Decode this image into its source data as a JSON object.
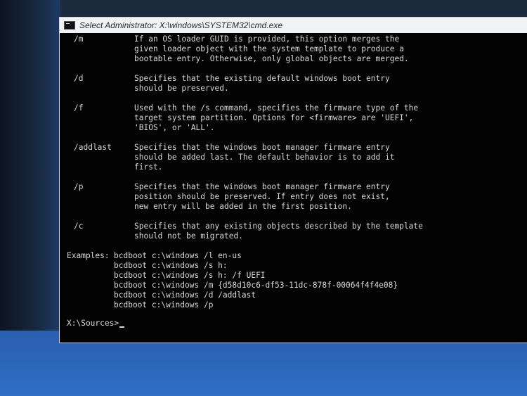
{
  "window": {
    "title": "Select Administrator: X:\\windows\\SYSTEM32\\cmd.exe"
  },
  "console": {
    "options": [
      {
        "flag": "/m",
        "desc": "If an OS loader GUID is provided, this option merges the\ngiven loader object with the system template to produce a\nbootable entry. Otherwise, only global objects are merged."
      },
      {
        "flag": "/d",
        "desc": "Specifies that the existing default windows boot entry\nshould be preserved."
      },
      {
        "flag": "/f",
        "desc": "Used with the /s command, specifies the firmware type of the\ntarget system partition. Options for <firmware> are 'UEFI',\n'BIOS', or 'ALL'."
      },
      {
        "flag": "/addlast",
        "desc": "Specifies that the windows boot manager firmware entry\nshould be added last. The default behavior is to add it\nfirst."
      },
      {
        "flag": "/p",
        "desc": "Specifies that the windows boot manager firmware entry\nposition should be preserved. If entry does not exist,\nnew entry will be added in the first position."
      },
      {
        "flag": "/c",
        "desc": "Specifies that any existing objects described by the template\nshould not be migrated."
      }
    ],
    "examples_label": "Examples:",
    "examples": "bcdboot c:\\windows /l en-us\nbcdboot c:\\windows /s h:\nbcdboot c:\\windows /s h: /f UEFI\nbcdboot c:\\windows /m {d58d10c6-df53-11dc-878f-00064f4f4e08}\nbcdboot c:\\windows /d /addlast\nbcdboot c:\\windows /p",
    "prompt": "X:\\Sources>"
  }
}
